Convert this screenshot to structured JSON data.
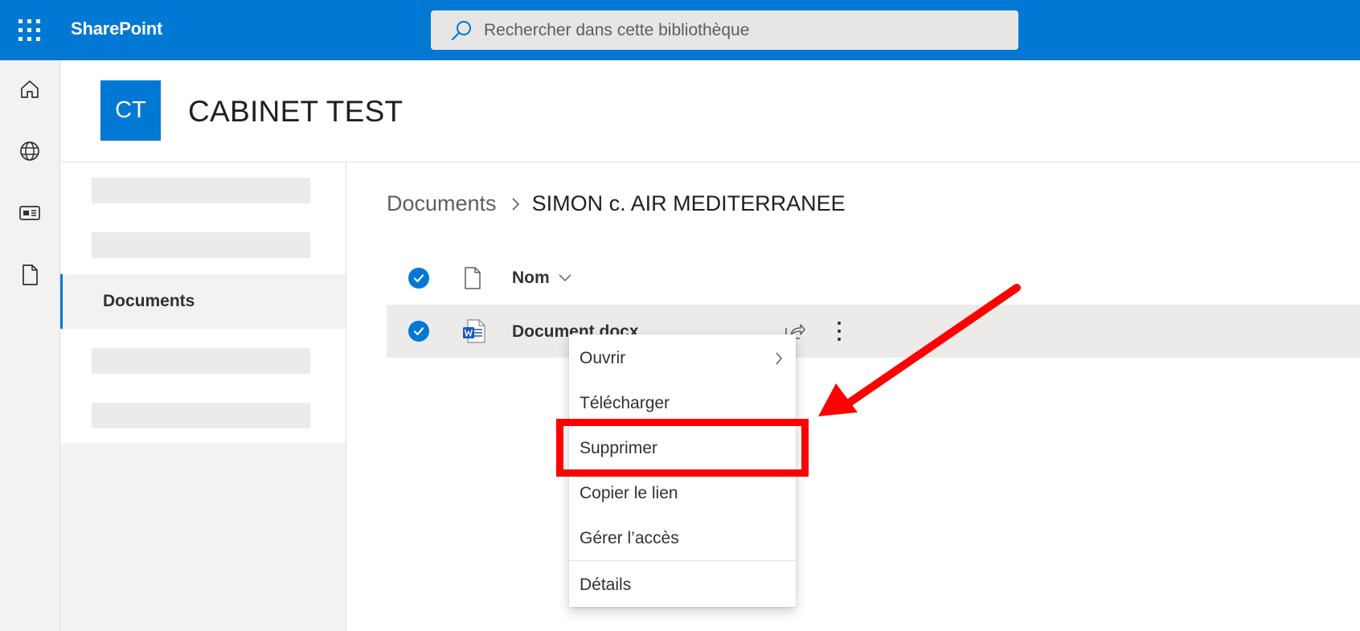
{
  "topbar": {
    "brand": "SharePoint",
    "search_placeholder": "Rechercher dans cette bibliothèque"
  },
  "rail": {
    "items": [
      {
        "icon": "home-icon"
      },
      {
        "icon": "globe-icon"
      },
      {
        "icon": "news-icon"
      },
      {
        "icon": "file-icon"
      }
    ]
  },
  "site": {
    "logo_initials": "CT",
    "title": "CABINET TEST"
  },
  "leftnav": {
    "active_item": "Documents"
  },
  "breadcrumb": {
    "root": "Documents",
    "current": "SIMON c. AIR MEDITERRANEE"
  },
  "list": {
    "column_name": "Nom",
    "rows": [
      {
        "name": "Document.docx"
      }
    ]
  },
  "context_menu": {
    "items": [
      {
        "label": "Ouvrir"
      },
      {
        "label": "Télécharger"
      },
      {
        "label": "Supprimer"
      },
      {
        "label": "Copier le lien"
      },
      {
        "label": "Gérer l’accès"
      },
      {
        "label": "Détails"
      }
    ]
  },
  "colors": {
    "brand_blue": "#0078d4",
    "annotation_red": "#ff0000"
  }
}
